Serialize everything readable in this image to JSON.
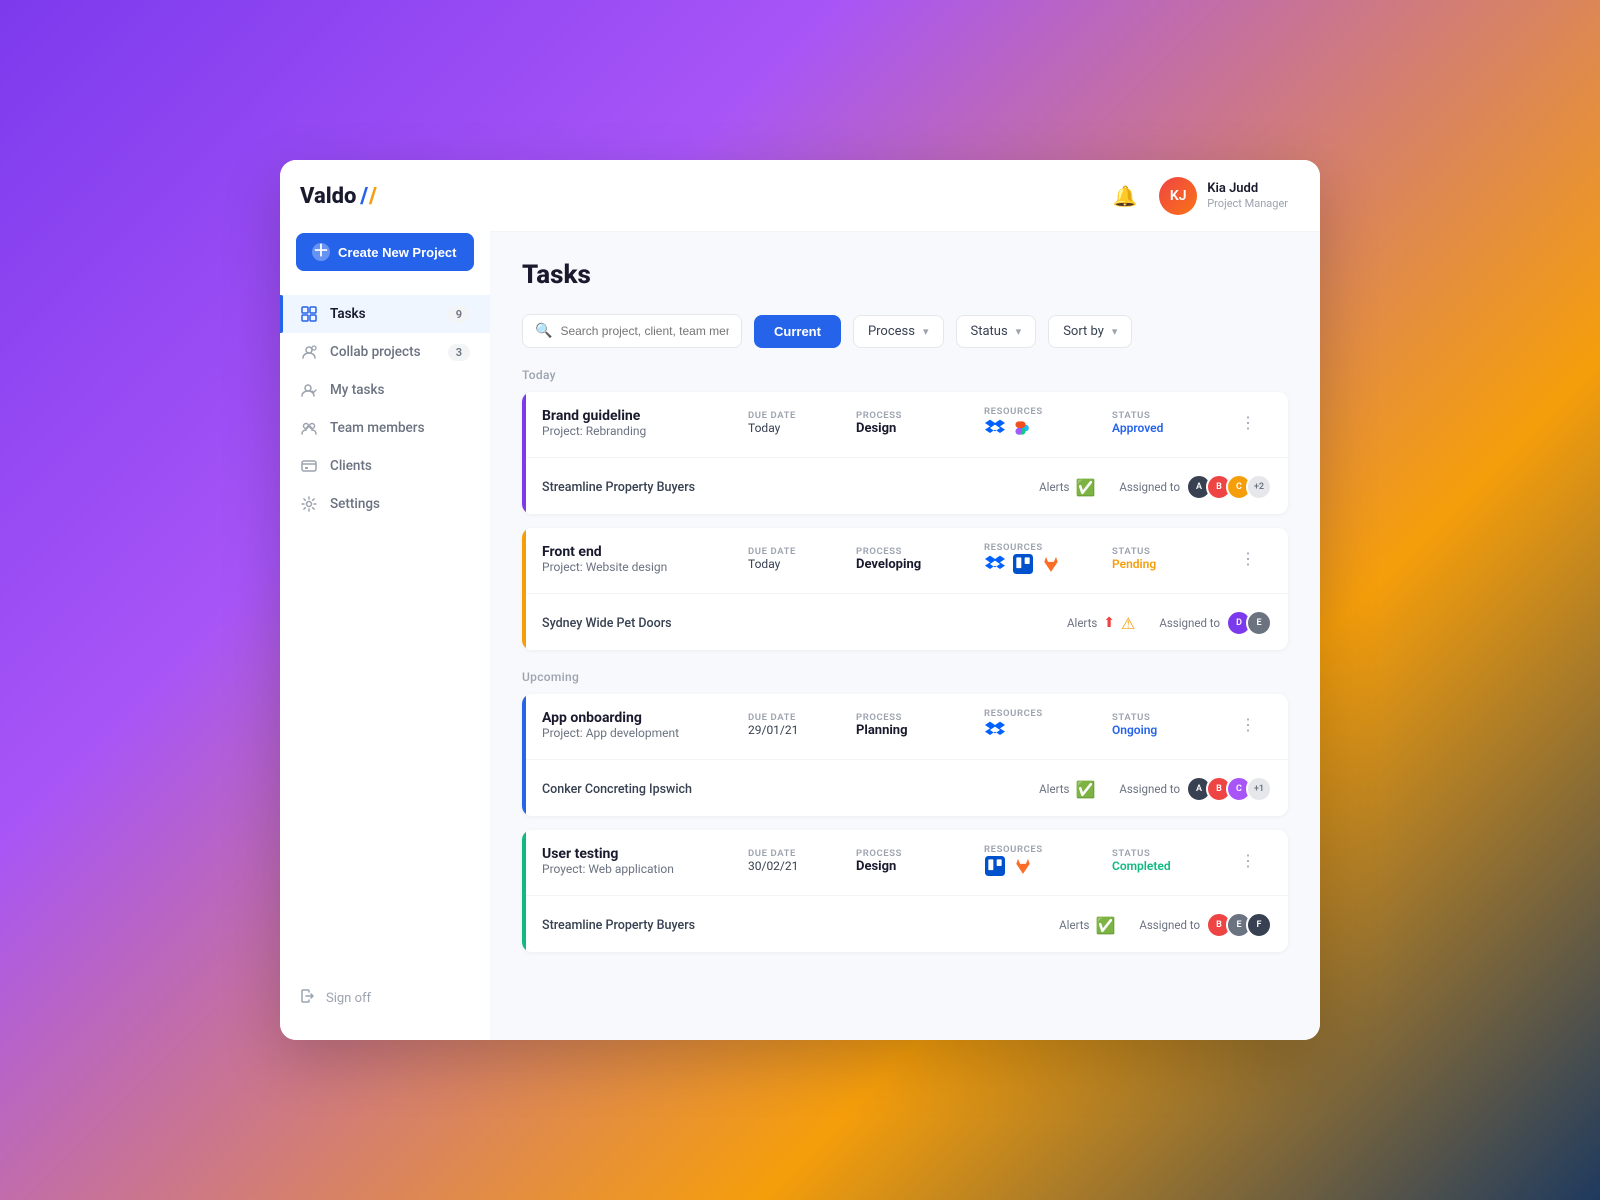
{
  "app": {
    "name": "Valdo",
    "logo_mark1": "/",
    "logo_mark2": "/"
  },
  "create_btn": "Create New Project",
  "sidebar": {
    "items": [
      {
        "id": "tasks",
        "label": "Tasks",
        "badge": "9",
        "active": true
      },
      {
        "id": "collab",
        "label": "Collab projects",
        "badge": "3",
        "active": false
      },
      {
        "id": "mytasks",
        "label": "My tasks",
        "badge": "",
        "active": false
      },
      {
        "id": "team",
        "label": "Team members",
        "badge": "",
        "active": false
      },
      {
        "id": "clients",
        "label": "Clients",
        "badge": "",
        "active": false
      },
      {
        "id": "settings",
        "label": "Settings",
        "badge": "",
        "active": false
      }
    ],
    "signoff": "Sign off"
  },
  "header": {
    "user_name": "Kia Judd",
    "user_role": "Project Manager"
  },
  "page": {
    "title": "Tasks"
  },
  "filters": {
    "search_placeholder": "Search project, client, team member",
    "current_label": "Current",
    "process_label": "Process",
    "status_label": "Status",
    "sortby_label": "Sort by"
  },
  "sections": [
    {
      "label": "Today",
      "tasks": [
        {
          "title": "Brand guideline",
          "project": "Project: Rebranding",
          "due_date_label": "DUE DATE",
          "due_date": "Today",
          "process_label": "PROCESS",
          "process": "Design",
          "resources_label": "RESOURCES",
          "resources": [
            "dropbox",
            "figma"
          ],
          "status_label": "STATUS",
          "status": "Approved",
          "status_type": "approved",
          "client": "Streamline Property Buyers",
          "alert_type": "check",
          "assigned_count": "+2",
          "avatars": [
            {
              "color": "#374151",
              "initials": "A"
            },
            {
              "color": "#ef4444",
              "initials": "B"
            },
            {
              "color": "#f59e0b",
              "initials": "C"
            }
          ],
          "border_color": "purple"
        },
        {
          "title": "Front end",
          "project": "Project: Website design",
          "due_date_label": "DUE DATE",
          "due_date": "Today",
          "process_label": "PROCESS",
          "process": "Developing",
          "resources_label": "RESOURCES",
          "resources": [
            "dropbox",
            "trello",
            "gitlab"
          ],
          "status_label": "STATUS",
          "status": "Pending",
          "status_type": "pending",
          "client": "Sydney Wide Pet Doors",
          "alert_type": "warn",
          "assigned_count": "",
          "avatars": [
            {
              "color": "#7c3aed",
              "initials": "D"
            },
            {
              "color": "#6b7280",
              "initials": "E"
            }
          ],
          "border_color": "yellow"
        }
      ]
    },
    {
      "label": "Upcoming",
      "tasks": [
        {
          "title": "App onboarding",
          "project": "Project: App development",
          "due_date_label": "DUE DATE",
          "due_date": "29/01/21",
          "process_label": "PROCESS",
          "process": "Planning",
          "resources_label": "RESOURCES",
          "resources": [
            "dropbox"
          ],
          "status_label": "STATUS",
          "status": "Ongoing",
          "status_type": "ongoing",
          "client": "Conker Concreting Ipswich",
          "alert_type": "check",
          "assigned_count": "+1",
          "avatars": [
            {
              "color": "#374151",
              "initials": "A"
            },
            {
              "color": "#ef4444",
              "initials": "B"
            },
            {
              "color": "#a855f7",
              "initials": "C"
            }
          ],
          "border_color": "blue"
        },
        {
          "title": "User testing",
          "project": "Proyect: Web application",
          "due_date_label": "DUE DATE",
          "due_date": "30/02/21",
          "process_label": "PROCESS",
          "process": "Design",
          "resources_label": "RESOURCES",
          "resources": [
            "trello",
            "gitlab"
          ],
          "status_label": "STATUS",
          "status": "Completed",
          "status_type": "completed",
          "client": "Streamline Property Buyers",
          "alert_type": "check",
          "assigned_count": "",
          "avatars": [
            {
              "color": "#ef4444",
              "initials": "B"
            },
            {
              "color": "#6b7280",
              "initials": "E"
            },
            {
              "color": "#374151",
              "initials": "F"
            }
          ],
          "border_color": "teal"
        }
      ]
    }
  ]
}
